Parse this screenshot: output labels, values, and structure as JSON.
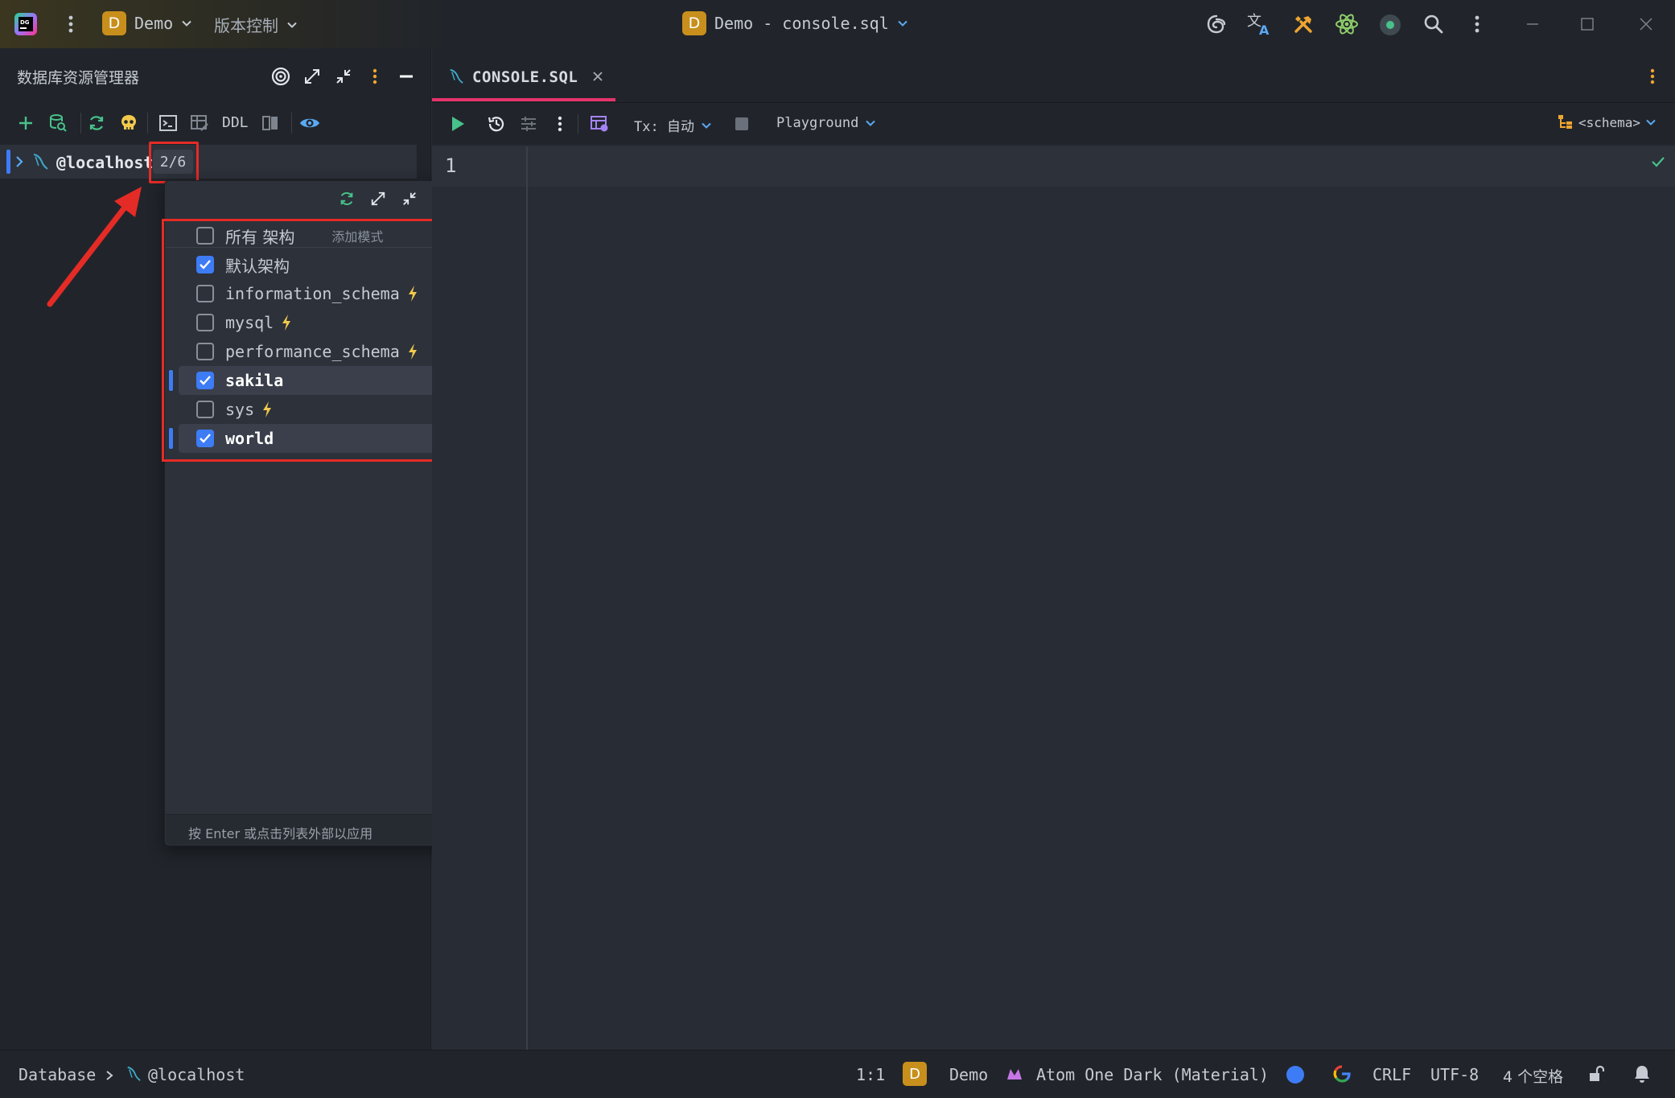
{
  "titlebar": {
    "project_badge": "D",
    "project_name": "Demo",
    "vcs_label": "版本控制",
    "window_title_badge": "D",
    "window_title": "Demo - console.sql",
    "icons": [
      "ide-logo-icon",
      "main-menu-icon",
      "ai-assistant-icon",
      "translate-icon",
      "build-tools-icon",
      "atom-plugin-icon",
      "status-dot-icon",
      "search-icon",
      "more-vert-icon",
      "minimize-icon",
      "maximize-icon",
      "close-icon"
    ]
  },
  "db_explorer": {
    "title": "数据库资源管理器",
    "toolbar": {
      "ddl_label": "DDL"
    },
    "tree": {
      "connection_label": "@localhost",
      "schema_count": "2/6"
    }
  },
  "schema_popup": {
    "rows": [
      {
        "label": "所有 架构",
        "checked": false,
        "hint": "添加模式",
        "selected": false,
        "bolt": false
      },
      {
        "label": "默认架构",
        "checked": true,
        "selected": false,
        "bolt": false
      },
      {
        "label": "information_schema",
        "checked": false,
        "selected": false,
        "bolt": true
      },
      {
        "label": "mysql",
        "checked": false,
        "selected": false,
        "bolt": true
      },
      {
        "label": "performance_schema",
        "checked": false,
        "selected": false,
        "bolt": true
      },
      {
        "label": "sakila",
        "checked": true,
        "selected": true,
        "bolt": false
      },
      {
        "label": "sys",
        "checked": false,
        "selected": false,
        "bolt": true
      },
      {
        "label": "world",
        "checked": true,
        "selected": true,
        "bolt": false
      }
    ],
    "footer": "按 Enter 或点击列表外部以应用"
  },
  "editor": {
    "tab_label": "CONSOLE.SQL",
    "toolbar": {
      "tx_label": "Tx: 自动",
      "playground_label": "Playground",
      "schema_label": "<schema>"
    },
    "line_number": "1"
  },
  "statusbar": {
    "breadcrumb_root": "Database",
    "breadcrumb_item": "@localhost",
    "position": "1:1",
    "project_badge": "D",
    "project_name": "Demo",
    "theme": "Atom One Dark (Material)",
    "line_ending": "CRLF",
    "encoding": "UTF-8",
    "indent": "4 个空格"
  },
  "colors": {
    "accent_blue": "#3d7cf5",
    "highlight_red": "#e52b26",
    "tab_underline": "#e5336a",
    "project_badge": "#c88f1c",
    "bolt_yellow": "#f2c94c"
  }
}
